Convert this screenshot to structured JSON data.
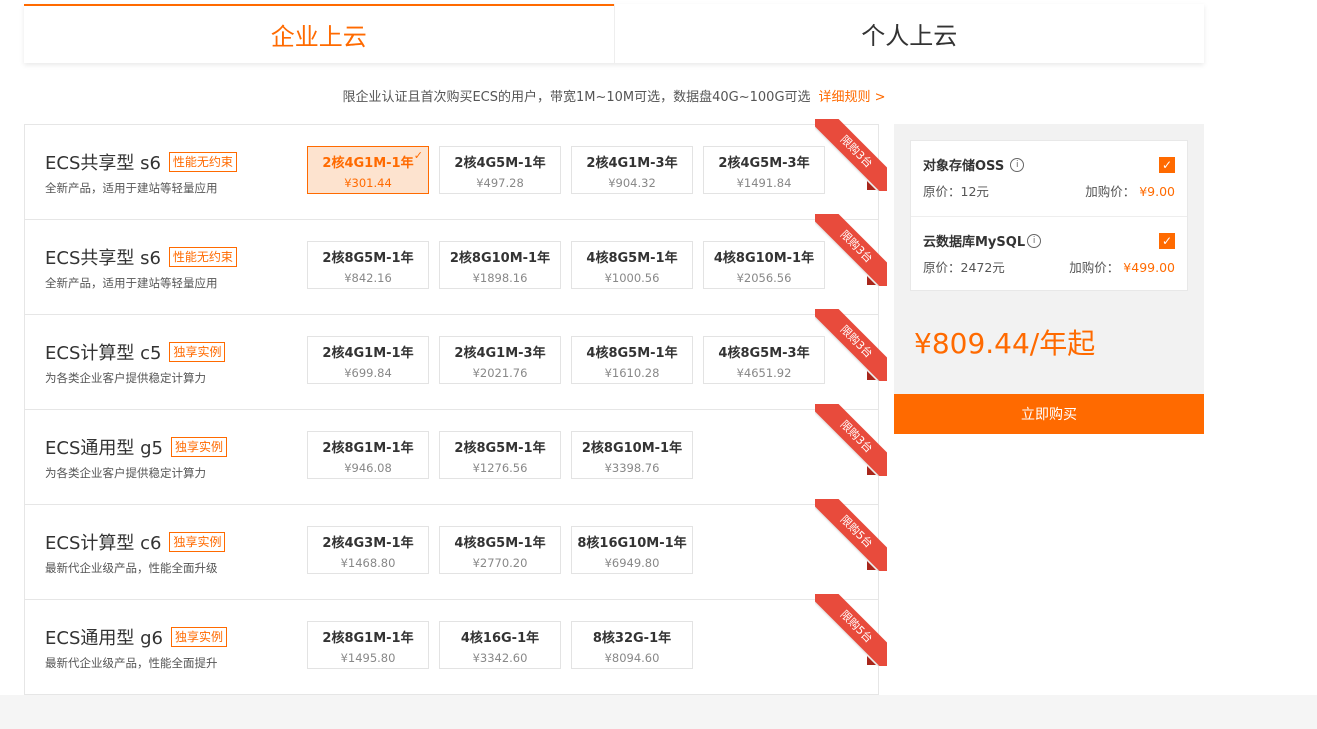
{
  "tabs": [
    {
      "label": "企业上云",
      "active": true
    },
    {
      "label": "个人上云",
      "active": false
    }
  ],
  "notice": {
    "text": "限企业认证且首次购买ECS的用户，带宽1M~10M可选，数据盘40G~100G可选",
    "link": "详细规则 >"
  },
  "products": [
    {
      "name": "ECS共享型 s6",
      "badge": "性能无约束",
      "desc": "全新产品，适用于建站等轻量应用",
      "ribbon": "限购3台",
      "options": [
        {
          "label": "2核4G1M-1年",
          "price": "¥301.44",
          "selected": true
        },
        {
          "label": "2核4G5M-1年",
          "price": "¥497.28"
        },
        {
          "label": "2核4G1M-3年",
          "price": "¥904.32"
        },
        {
          "label": "2核4G5M-3年",
          "price": "¥1491.84"
        }
      ]
    },
    {
      "name": "ECS共享型 s6",
      "badge": "性能无约束",
      "desc": "全新产品，适用于建站等轻量应用",
      "ribbon": "限购3台",
      "options": [
        {
          "label": "2核8G5M-1年",
          "price": "¥842.16"
        },
        {
          "label": "2核8G10M-1年",
          "price": "¥1898.16"
        },
        {
          "label": "4核8G5M-1年",
          "price": "¥1000.56"
        },
        {
          "label": "4核8G10M-1年",
          "price": "¥2056.56"
        }
      ]
    },
    {
      "name": "ECS计算型 c5",
      "badge": "独享实例",
      "desc": "为各类企业客户提供稳定计算力",
      "ribbon": "限购3台",
      "options": [
        {
          "label": "2核4G1M-1年",
          "price": "¥699.84"
        },
        {
          "label": "2核4G1M-3年",
          "price": "¥2021.76"
        },
        {
          "label": "4核8G5M-1年",
          "price": "¥1610.28"
        },
        {
          "label": "4核8G5M-3年",
          "price": "¥4651.92"
        }
      ]
    },
    {
      "name": "ECS通用型 g5",
      "badge": "独享实例",
      "desc": "为各类企业客户提供稳定计算力",
      "ribbon": "限购3台",
      "options": [
        {
          "label": "2核8G1M-1年",
          "price": "¥946.08"
        },
        {
          "label": "2核8G5M-1年",
          "price": "¥1276.56"
        },
        {
          "label": "2核8G10M-1年",
          "price": "¥3398.76"
        }
      ]
    },
    {
      "name": "ECS计算型 c6",
      "badge": "独享实例",
      "desc": "最新代企业级产品，性能全面升级",
      "ribbon": "限购5台",
      "options": [
        {
          "label": "2核4G3M-1年",
          "price": "¥1468.80"
        },
        {
          "label": "4核8G5M-1年",
          "price": "¥2770.20"
        },
        {
          "label": "8核16G10M-1年",
          "price": "¥6949.80"
        }
      ]
    },
    {
      "name": "ECS通用型 g6",
      "badge": "独享实例",
      "desc": "最新代企业级产品，性能全面提升",
      "ribbon": "限购5台",
      "options": [
        {
          "label": "2核8G1M-1年",
          "price": "¥1495.80"
        },
        {
          "label": "4核16G-1年",
          "price": "¥3342.60"
        },
        {
          "label": "8核32G-1年",
          "price": "¥8094.60"
        }
      ]
    }
  ],
  "addons": [
    {
      "name": "对象存储OSS",
      "orig": "原价：12元",
      "add_label": "加购价：",
      "add_price": "¥9.00",
      "checked": true
    },
    {
      "name": "云数据库MySQL",
      "orig": "原价：2472元",
      "add_label": "加购价：",
      "add_price": "¥499.00",
      "checked": true
    }
  ],
  "total": "¥809.44/年起",
  "buy_label": "立即购买",
  "colors": {
    "accent": "#ff6a00",
    "ribbon": "#e84b3c"
  }
}
